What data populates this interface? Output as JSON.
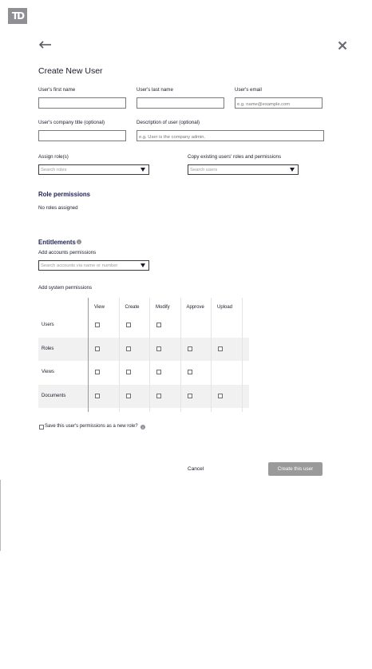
{
  "brand": {
    "logo_text": "TD",
    "logo_color": "#8f8f94"
  },
  "header": {
    "title": "Create New User",
    "back_icon": "arrow-left-icon",
    "close_icon": "close-icon"
  },
  "form": {
    "first_name": {
      "label": "User's first name",
      "value": "",
      "placeholder": ""
    },
    "last_name": {
      "label": "User's last name",
      "value": "",
      "placeholder": ""
    },
    "email": {
      "label": "User's email",
      "value": "",
      "placeholder": "e.g. name@example.com"
    },
    "company_title": {
      "label": "User's company title (optional)",
      "value": "",
      "placeholder": ""
    },
    "description": {
      "label": "Description of user (optional)",
      "value": "",
      "placeholder": "e.g. User is the company admin."
    },
    "assign_roles": {
      "label": "Assign role(s)",
      "placeholder": "Search roles"
    },
    "copy_users": {
      "label": "Copy existing users' roles and permissions",
      "placeholder": "Search users"
    }
  },
  "role_permissions": {
    "heading": "Role permissions",
    "empty_text": "No roles assigned"
  },
  "entitlements": {
    "heading": "Entitlements",
    "info_icon": "info-icon",
    "accounts_label": "Add accounts permissions",
    "accounts_placeholder": "Search accounts via name or number",
    "system_label": "Add system permissions"
  },
  "permissions_grid": {
    "columns": [
      "View",
      "Create",
      "Modify",
      "Approve",
      "Upload"
    ],
    "rows": [
      {
        "label": "Users",
        "checkboxes": [
          true,
          true,
          true,
          false,
          false
        ]
      },
      {
        "label": "Roles",
        "checkboxes": [
          true,
          true,
          true,
          true,
          true
        ]
      },
      {
        "label": "Views",
        "checkboxes": [
          true,
          true,
          true,
          true,
          false
        ]
      },
      {
        "label": "Documents",
        "checkboxes": [
          true,
          true,
          true,
          true,
          true
        ]
      }
    ],
    "band_color": "#f1f1f1"
  },
  "save_role": {
    "label": "Save this user's permissions as a new role?",
    "checked": false
  },
  "actions": {
    "cancel": "Cancel",
    "create": "Create this user",
    "create_color": "#9a9a9a"
  }
}
